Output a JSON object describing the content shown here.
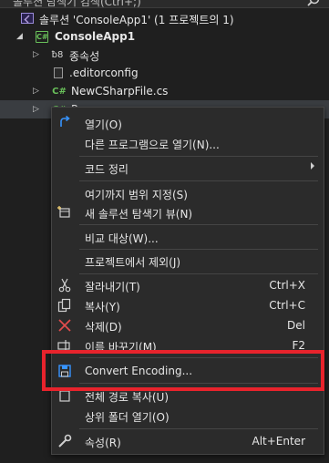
{
  "search": {
    "placeholder": "솔루션 탐색기 검색(Ctrl+;)"
  },
  "tree": {
    "solution": "솔루션 'ConsoleApp1' (1 프로젝트의 1)",
    "project": "ConsoleApp1",
    "items": [
      {
        "label": "종속성",
        "icon": "dependencies-icon"
      },
      {
        "label": ".editorconfig",
        "icon": "config-file-icon"
      },
      {
        "label": "NewCSharpFile.cs",
        "icon": "csharp-file-icon"
      },
      {
        "label": "Program.cs",
        "icon": "csharp-file-icon"
      }
    ],
    "cs_glyph": "C#"
  },
  "menu": {
    "open": "열기(O)",
    "open_with": "다른 프로그램으로 열기(N)...",
    "cleanup": "코드 정리",
    "scope": "여기까지 범위 지정(S)",
    "new_view": "새 솔루션 탐색기 뷰(N)",
    "compare": "비교 대상(W)...",
    "exclude": "프로젝트에서 제외(J)",
    "cut": "잘라내기(T)",
    "cut_sc": "Ctrl+X",
    "copy": "복사(Y)",
    "copy_sc": "Ctrl+C",
    "delete": "삭제(D)",
    "delete_sc": "Del",
    "rename": "이름 바꾸기(M)",
    "rename_sc": "F2",
    "convert": "Convert Encoding...",
    "copy_path": "전체 경로 복사(U)",
    "open_folder": "상위 폴더 열기(O)",
    "properties": "속성(R)",
    "properties_sc": "Alt+Enter"
  },
  "colors": {
    "highlight": "#e8232c",
    "csharp": "#69c05a",
    "open_icon": "#3794ff",
    "delete_icon": "#e24c4c"
  }
}
